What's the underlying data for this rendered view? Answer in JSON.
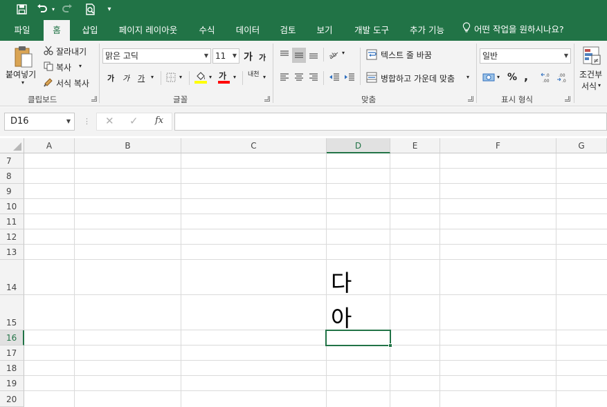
{
  "qat": {
    "icons": [
      "save-icon",
      "undo-icon",
      "redo-icon",
      "print-preview-icon",
      "customize-icon"
    ]
  },
  "tabs": [
    {
      "label": "파일"
    },
    {
      "label": "홈"
    },
    {
      "label": "삽입"
    },
    {
      "label": "페이지 레이아웃"
    },
    {
      "label": "수식"
    },
    {
      "label": "데이터"
    },
    {
      "label": "검토"
    },
    {
      "label": "보기"
    },
    {
      "label": "개발 도구"
    },
    {
      "label": "추가 기능"
    }
  ],
  "tell_me": "어떤 작업을 원하시나요?",
  "ribbon": {
    "clipboard": {
      "paste": "붙여넣기",
      "cut": "잘라내기",
      "copy": "복사",
      "format_painter": "서식 복사",
      "group_label": "클립보드"
    },
    "font": {
      "font_name": "맑은 고딕",
      "font_size": "11",
      "grow": "가",
      "shrink": "가",
      "bold": "가",
      "italic": "가",
      "underline": "가",
      "font_color_glyph": "가",
      "phonetic": "내천",
      "group_label": "글꼴"
    },
    "alignment": {
      "wrap_text": "텍스트 줄 바꿈",
      "merge_center": "병합하고 가운데 맞춤",
      "group_label": "맞춤"
    },
    "number": {
      "format": "일반",
      "percent": "%",
      "comma": ",",
      "group_label": "표시 형식"
    },
    "styles": {
      "conditional_line1": "조건부",
      "conditional_line2": "서식"
    },
    "colors": {
      "accent": "#217346",
      "highlight_yellow": "#ffff00",
      "font_red": "#ff0000"
    }
  },
  "formula_bar": {
    "name_box": "D16",
    "fx": "fx",
    "formula": ""
  },
  "grid": {
    "columns": [
      "A",
      "B",
      "C",
      "D",
      "E",
      "F",
      "G"
    ],
    "selected_column": "D",
    "rows": [
      "7",
      "8",
      "9",
      "10",
      "11",
      "12",
      "13",
      "14",
      "15",
      "16",
      "17",
      "18",
      "19",
      "20"
    ],
    "selected_row": "16",
    "cells": {
      "D14": "다",
      "D15": "아"
    }
  }
}
